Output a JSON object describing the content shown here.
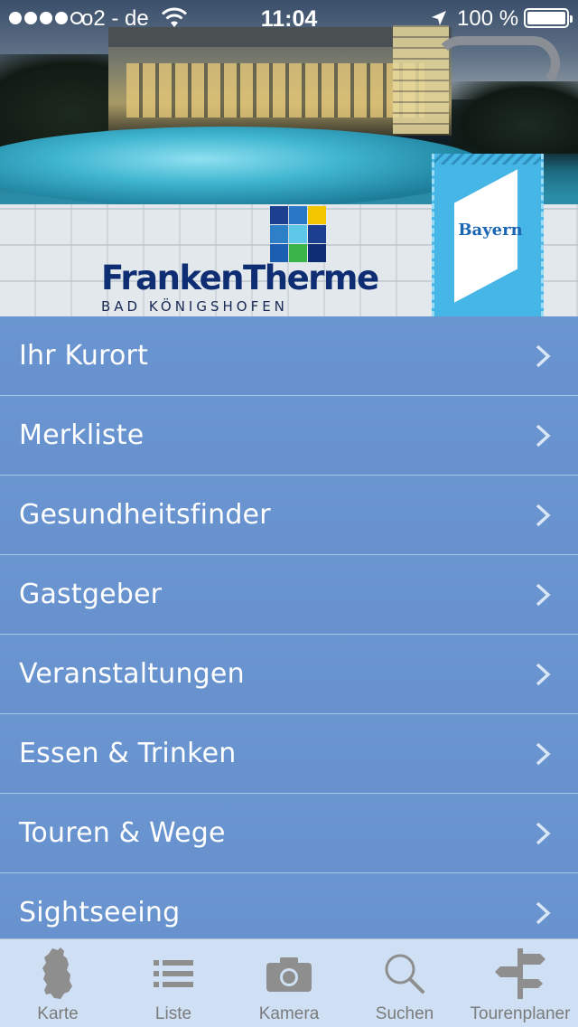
{
  "status_bar": {
    "carrier": "o2 - de",
    "time": "11:04",
    "battery": "100 %"
  },
  "header": {
    "brand_name": "FrankenTherme",
    "brand_sub": "BAD KÖNIGSHOFEN",
    "tag_label": "Bayern",
    "logo_colors": [
      "#1c3f8f",
      "#2a77c6",
      "#f2c500",
      "#2d7fc8",
      "#5ec8e8",
      "#1c3f8f",
      "#1c5fb0",
      "#3ab54a",
      "#0f2d72"
    ]
  },
  "menu": {
    "items": [
      {
        "label": "Ihr Kurort"
      },
      {
        "label": "Merkliste"
      },
      {
        "label": "Gesundheitsfinder"
      },
      {
        "label": "Gastgeber"
      },
      {
        "label": "Veranstaltungen"
      },
      {
        "label": "Essen & Trinken"
      },
      {
        "label": "Touren & Wege"
      },
      {
        "label": "Sightseeing"
      }
    ]
  },
  "tabbar": {
    "items": [
      {
        "label": "Karte",
        "icon": "germany-map-icon"
      },
      {
        "label": "Liste",
        "icon": "list-icon"
      },
      {
        "label": "Kamera",
        "icon": "camera-icon"
      },
      {
        "label": "Suchen",
        "icon": "search-icon"
      },
      {
        "label": "Tourenplaner",
        "icon": "signpost-icon"
      }
    ]
  },
  "colors": {
    "menu_background": "#6a96d1",
    "tabbar_background": "#cfe0f4",
    "brand_blue": "#0f2d72"
  }
}
